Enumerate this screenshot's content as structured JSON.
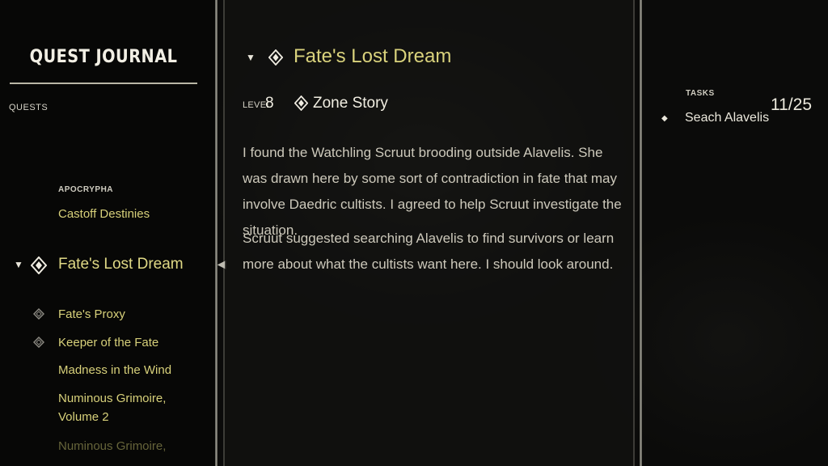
{
  "journal": {
    "title": "QUEST JOURNAL",
    "quests_label": "QUESTS",
    "quests_count": "11/25"
  },
  "quest_list": {
    "category": "APOCRYPHA",
    "items": [
      {
        "label": "Castoff Destinies",
        "icon": "none"
      },
      {
        "label": "Fate's Lost Dream",
        "icon": "quest-marker-icon",
        "selected": true
      },
      {
        "label": "Fate's Proxy",
        "icon": "quest-marker-outline-icon"
      },
      {
        "label": "Keeper of the Fate",
        "icon": "quest-marker-outline-icon"
      },
      {
        "label": "Madness in the Wind",
        "icon": "none"
      },
      {
        "label": "Numinous Grimoire,",
        "label2": "Volume 2",
        "icon": "none"
      },
      {
        "label": "Numinous Grimoire,",
        "icon": "none",
        "faded": true
      }
    ]
  },
  "detail": {
    "title": "Fate's Lost Dream",
    "level_label": "LEVEL",
    "level_value": "8",
    "zone_label": "Zone Story",
    "paragraph1": "I found the Watchling Scruut brooding outside Alavelis. She was drawn here by some sort of contradiction in fate that may involve Daedric cultists. I agreed to help Scruut investigate the situation.",
    "paragraph2": "Scruut suggested searching Alavelis to find survivors or learn more about what the cultists want here. I should look around."
  },
  "tasks": {
    "label": "TASKS",
    "items": [
      {
        "text": "Seach Alavelis"
      }
    ]
  },
  "colors": {
    "quest_gold": "#d7d07a",
    "text": "#cdc9bb",
    "background": "#0b0b0a"
  }
}
